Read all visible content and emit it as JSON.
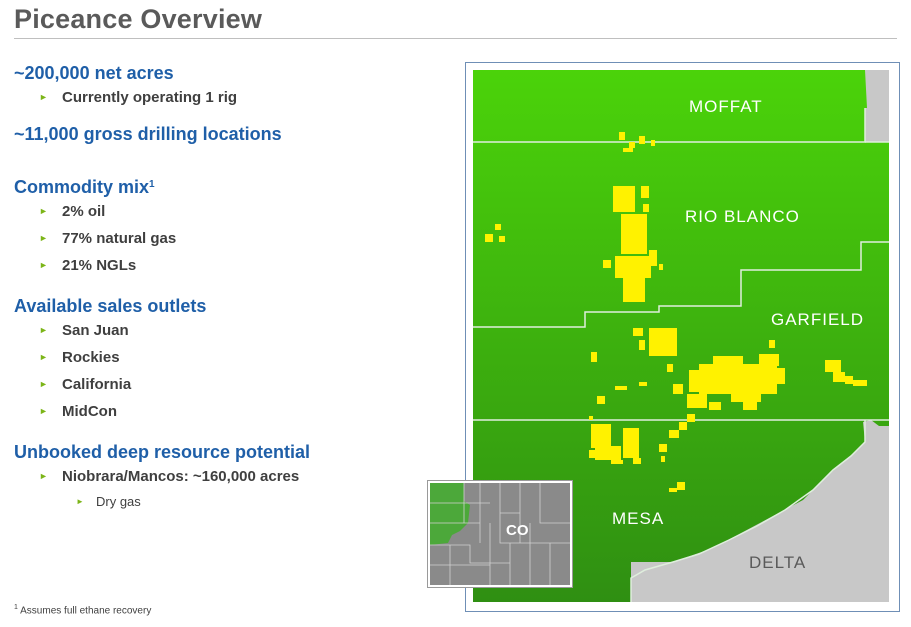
{
  "page": {
    "title": "Piceance Overview",
    "footnote_mark": "1",
    "footnote": "Assumes full ethane recovery"
  },
  "sections": [
    {
      "heading": "~200,000 net acres",
      "bullets": [
        "Currently operating 1 rig"
      ]
    },
    {
      "heading": "~11,000 gross drilling locations",
      "bullets": []
    },
    {
      "heading": "Commodity mix",
      "sup": "1",
      "bullets": [
        "2% oil",
        "77% natural gas",
        "21% NGLs"
      ]
    },
    {
      "heading": "Available sales outlets",
      "bullets": [
        "San Juan",
        "Rockies",
        "California",
        "MidCon"
      ]
    },
    {
      "heading": "Unbooked deep resource potential",
      "bullets": [
        "Niobrara/Mancos: ~160,000 acres"
      ],
      "subbullets": [
        "Dry gas"
      ]
    }
  ],
  "map": {
    "counties": [
      "MOFFAT",
      "RIO BLANCO",
      "GARFIELD",
      "MESA",
      "DELTA"
    ],
    "inset_label": "CO",
    "colors": {
      "green_top": "#49d10a",
      "green_bottom": "#2e8e12",
      "acreage": "#fff200",
      "other": "#c8c8c8",
      "border": "#d8e8d0"
    }
  }
}
